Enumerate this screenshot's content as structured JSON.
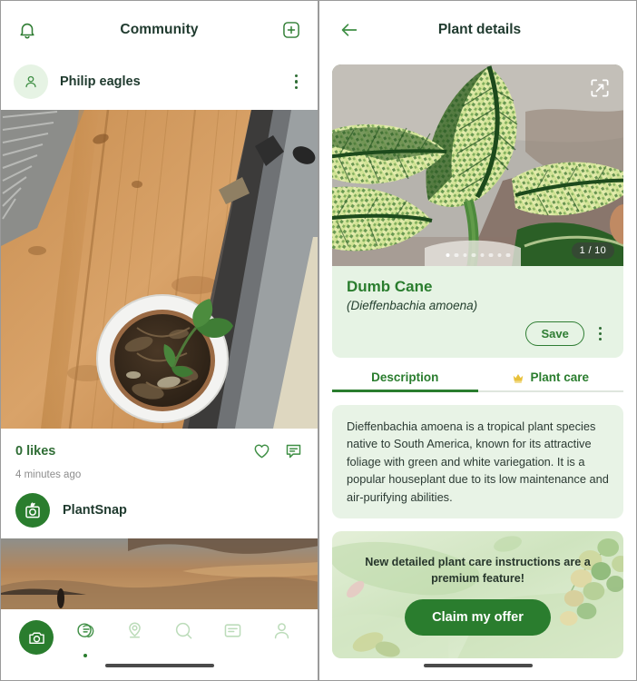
{
  "colors": {
    "brand_green": "#2a7d2e",
    "dark_green_text": "#1f3a2e",
    "light_green_bg": "#e6f3e4",
    "muted_gray": "#8d8d8d",
    "crown_gold": "#e8c13a"
  },
  "community": {
    "header": {
      "title": "Community",
      "bell_icon": "bell-icon",
      "add_icon": "plus-square-icon"
    },
    "post": {
      "author": "Philip eagles",
      "avatar_icon": "person-icon",
      "menu_icon": "kebab-menu-icon",
      "likes": "0 likes",
      "like_icon": "heart-icon",
      "comment_icon": "comment-icon",
      "timestamp": "4 minutes ago"
    },
    "post2": {
      "author": "PlantSnap",
      "avatar_icon": "plantsnap-logo-icon"
    },
    "bottom_nav": [
      {
        "name": "camera",
        "icon": "camera-icon",
        "active": true
      },
      {
        "name": "community",
        "icon": "community-chat-icon",
        "active": false,
        "dot": true
      },
      {
        "name": "explore",
        "icon": "location-pin-icon",
        "active": false
      },
      {
        "name": "search",
        "icon": "search-icon",
        "active": false
      },
      {
        "name": "articles",
        "icon": "article-icon",
        "active": false
      },
      {
        "name": "profile",
        "icon": "person-icon",
        "active": false
      }
    ]
  },
  "details": {
    "header": {
      "title": "Plant details",
      "back_icon": "arrow-left-icon"
    },
    "hero": {
      "expand_icon": "expand-fullscreen-icon",
      "counter": "1 / 10",
      "dots_total": 8,
      "dots_active_index": 0
    },
    "plant": {
      "common_name": "Dumb Cane",
      "latin_name": "(Dieffenbachia amoena)",
      "save_label": "Save",
      "menu_icon": "kebab-menu-icon"
    },
    "tabs": [
      {
        "label": "Description",
        "active": true,
        "icon": null
      },
      {
        "label": "Plant care",
        "active": false,
        "icon": "crown-icon"
      }
    ],
    "description": "Dieffenbachia amoena is a tropical plant species native to South America, known for its attractive foliage with green and white variegation. It is a popular houseplant due to its low maintenance and air-purifying abilities.",
    "promo": {
      "text": "New detailed plant care instructions are a premium feature!",
      "cta": "Claim my offer"
    }
  }
}
